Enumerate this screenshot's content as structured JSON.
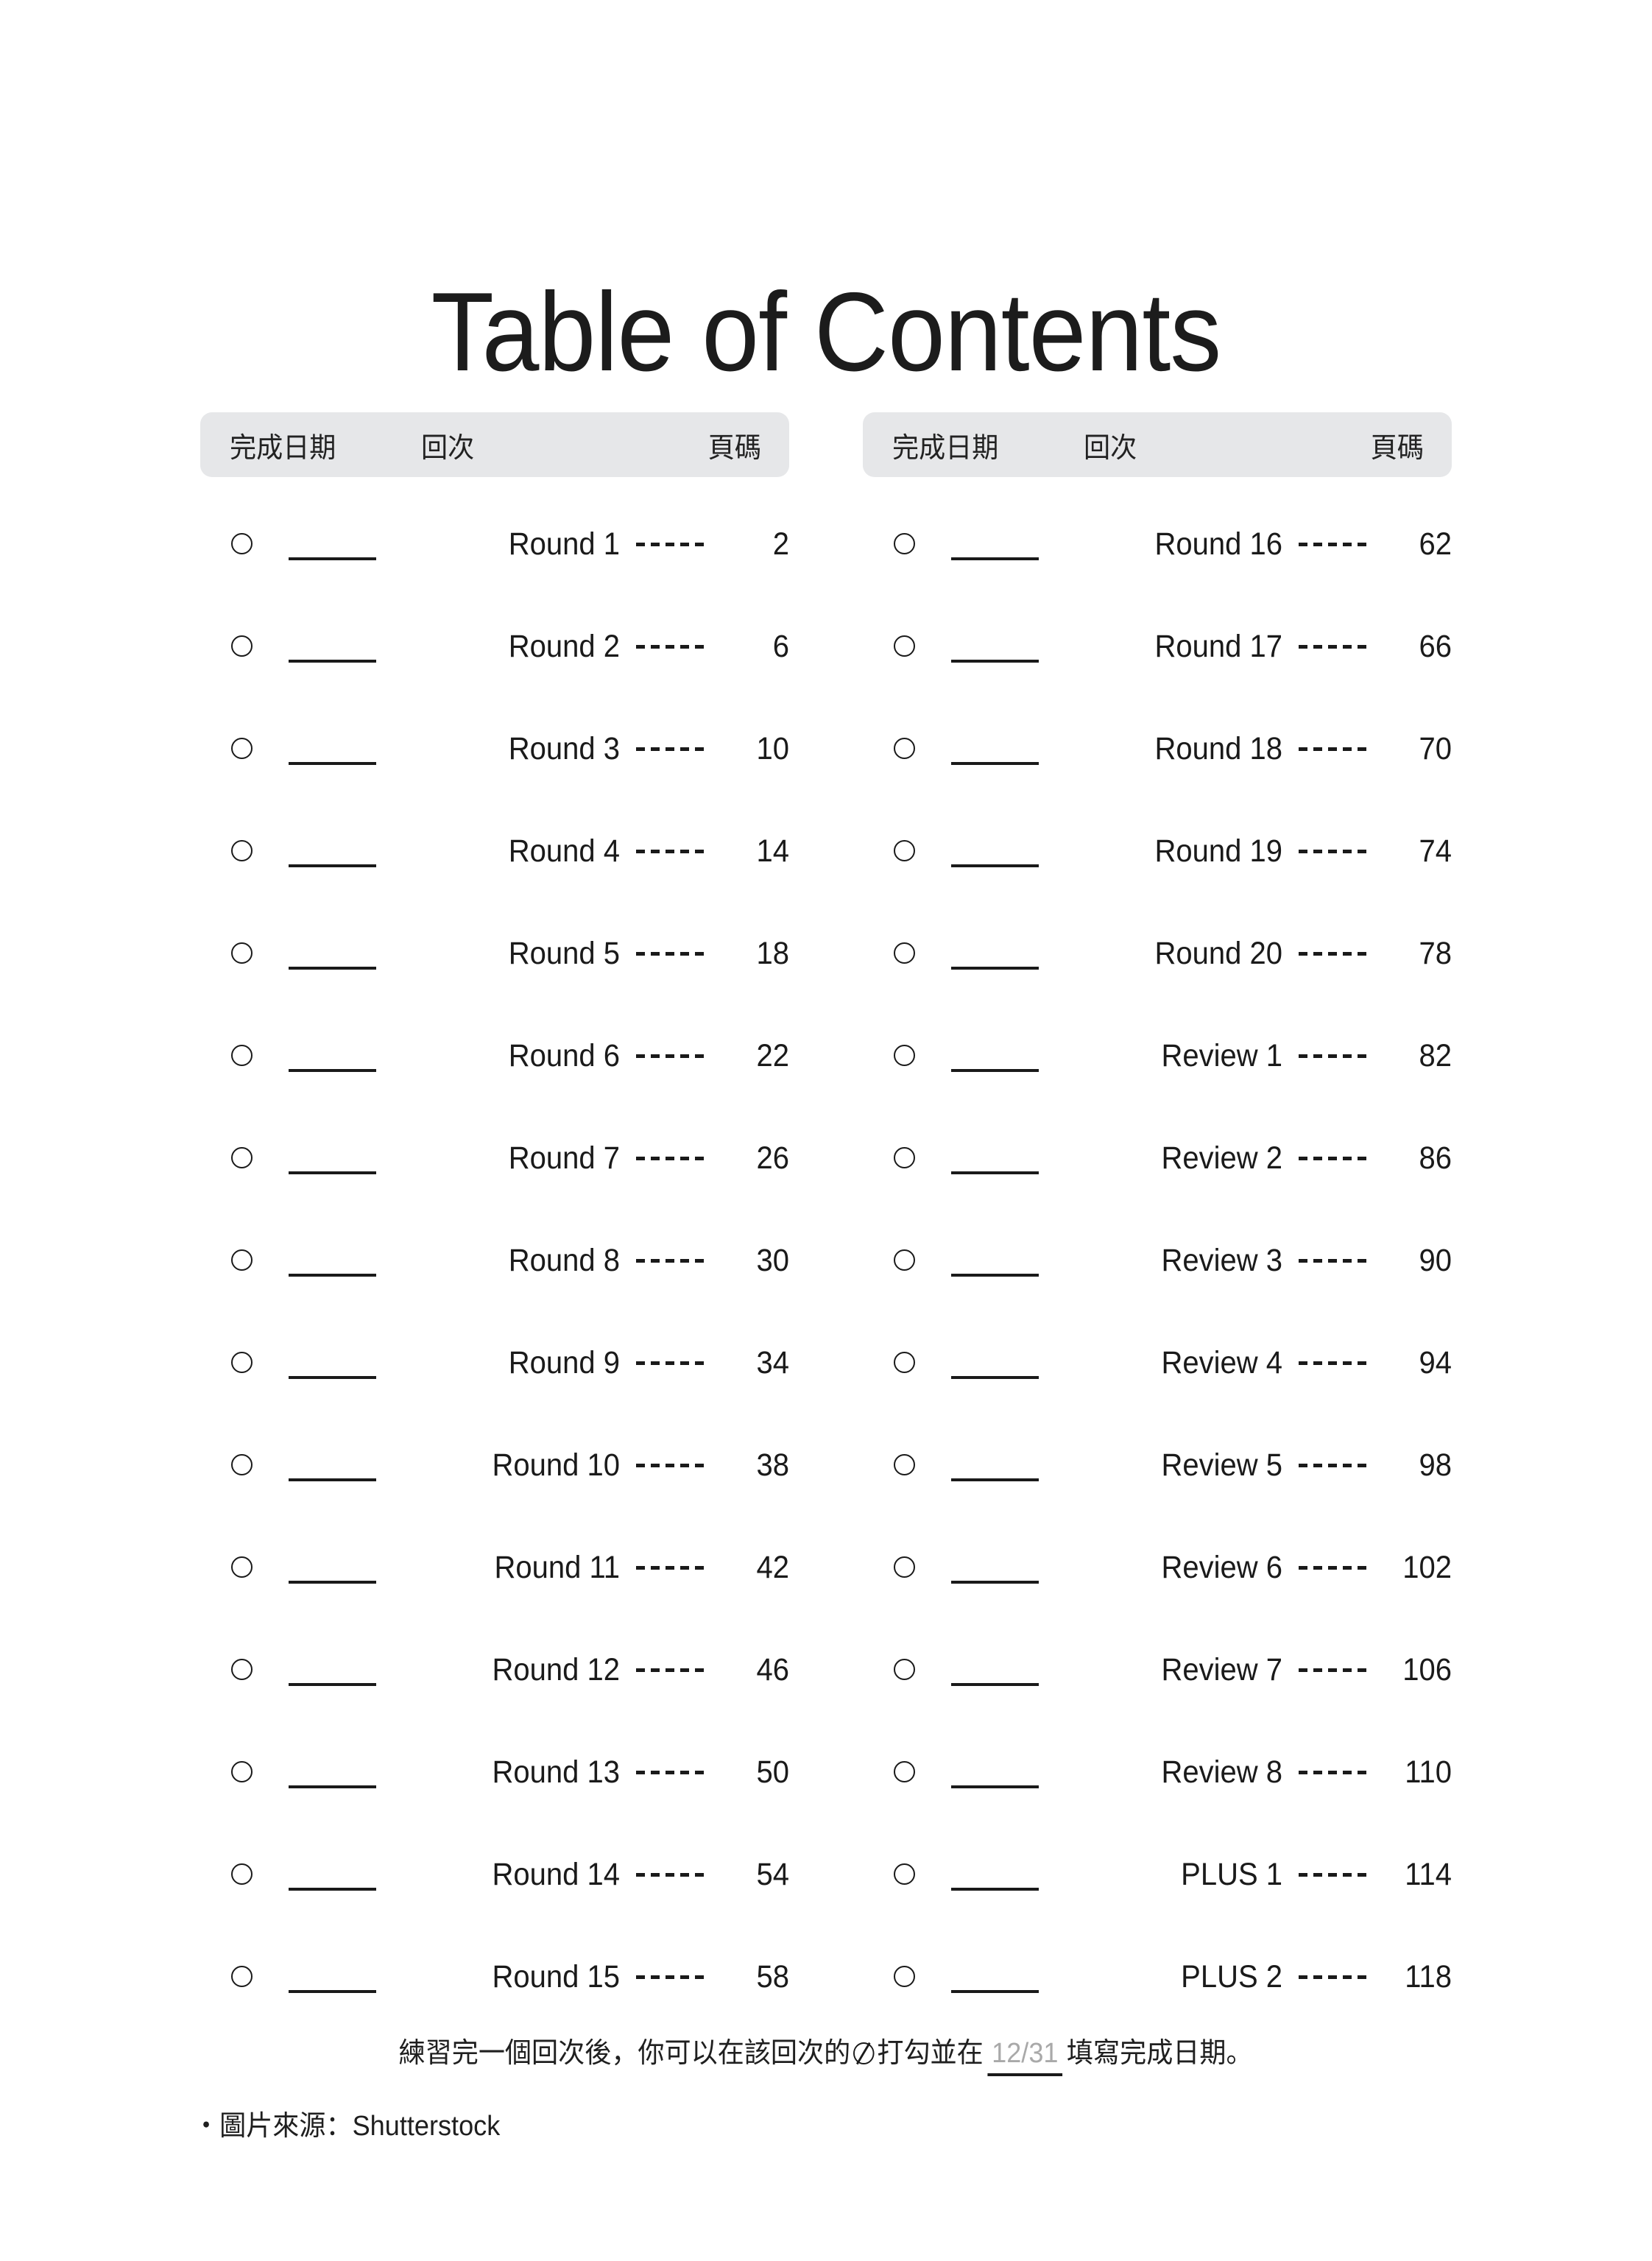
{
  "title": "Table of Contents",
  "columns": [
    {
      "header": {
        "date": "完成日期",
        "round": "回次",
        "page": "頁碼"
      },
      "rows": [
        {
          "label": "Round 1",
          "page": "2"
        },
        {
          "label": "Round 2",
          "page": "6"
        },
        {
          "label": "Round 3",
          "page": "10"
        },
        {
          "label": "Round 4",
          "page": "14"
        },
        {
          "label": "Round 5",
          "page": "18"
        },
        {
          "label": "Round 6",
          "page": "22"
        },
        {
          "label": "Round 7",
          "page": "26"
        },
        {
          "label": "Round 8",
          "page": "30"
        },
        {
          "label": "Round 9",
          "page": "34"
        },
        {
          "label": "Round 10",
          "page": "38"
        },
        {
          "label": "Round 11",
          "page": "42"
        },
        {
          "label": "Round 12",
          "page": "46"
        },
        {
          "label": "Round 13",
          "page": "50"
        },
        {
          "label": "Round 14",
          "page": "54"
        },
        {
          "label": "Round 15",
          "page": "58"
        }
      ]
    },
    {
      "header": {
        "date": "完成日期",
        "round": "回次",
        "page": "頁碼"
      },
      "rows": [
        {
          "label": "Round 16",
          "page": "62"
        },
        {
          "label": "Round 17",
          "page": "66"
        },
        {
          "label": "Round 18",
          "page": "70"
        },
        {
          "label": "Round 19",
          "page": "74"
        },
        {
          "label": "Round 20",
          "page": "78"
        },
        {
          "label": "Review 1",
          "page": "82"
        },
        {
          "label": "Review 2",
          "page": "86"
        },
        {
          "label": "Review 3",
          "page": "90"
        },
        {
          "label": "Review 4",
          "page": "94"
        },
        {
          "label": "Review 5",
          "page": "98"
        },
        {
          "label": "Review 6",
          "page": "102"
        },
        {
          "label": "Review 7",
          "page": "106"
        },
        {
          "label": "Review 8",
          "page": "110"
        },
        {
          "label": "PLUS 1",
          "page": "114"
        },
        {
          "label": "PLUS 2",
          "page": "118"
        }
      ]
    }
  ],
  "footnote": {
    "before": "練習完一個回次後，你可以在該回次的",
    "middle": "打勾並在",
    "date_sample": "12/31",
    "after": "填寫完成日期。"
  },
  "source": "・圖片來源：Shutterstock",
  "colors": {
    "header_pill": "#e6e7e9",
    "text": "#1a1a1a",
    "date_sample_gray": "#a9a9a9",
    "background": "#ffffff"
  }
}
